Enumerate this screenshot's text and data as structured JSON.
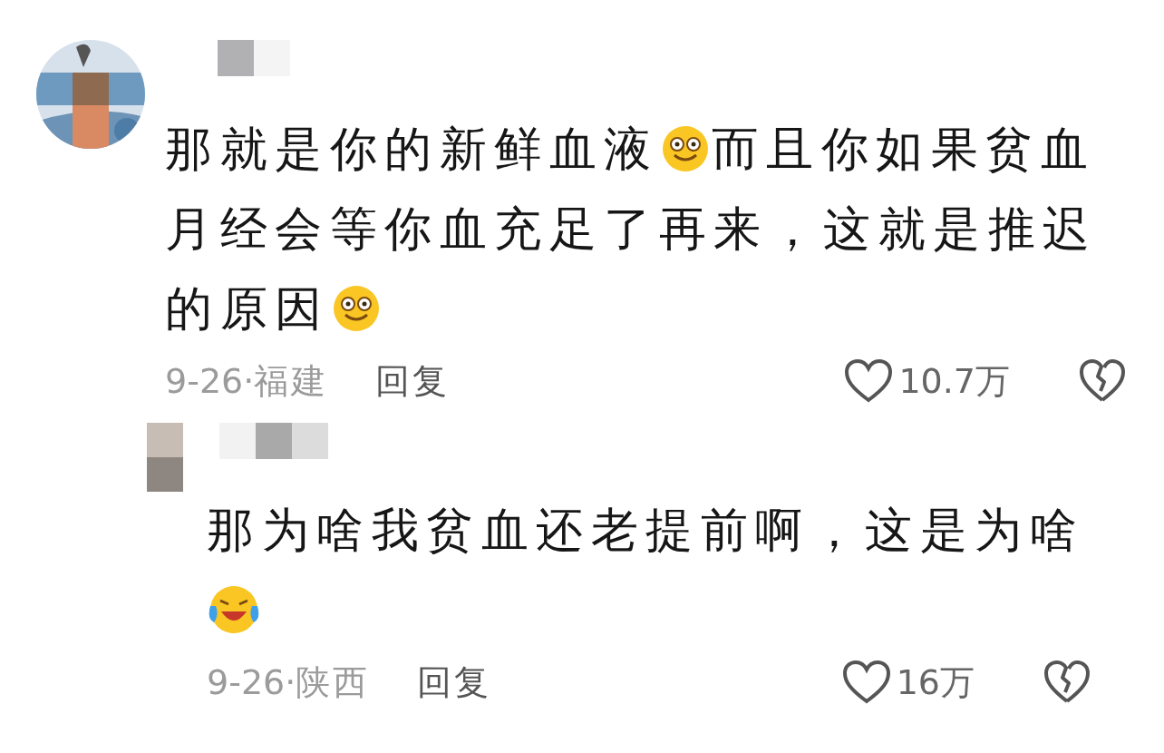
{
  "comments": [
    {
      "avatar": {
        "kind": "picture"
      },
      "body": [
        {
          "kind": "text",
          "text": "那就是你的新鲜血液"
        },
        {
          "kind": "smile"
        },
        {
          "kind": "text",
          "text": "而且你如果贫血月经会等你血充足了再来，这就是推迟的原因"
        },
        {
          "kind": "smile"
        }
      ],
      "date": "9-26·",
      "location": "福建",
      "reply": "回复",
      "likes": "10.7万",
      "replies": [
        {
          "avatar": {
            "kind": "picture"
          },
          "body": [
            {
              "kind": "text",
              "text": "那为啥我贫血还老提前啊，这是为啥"
            },
            {
              "kind": "laugh-cry"
            }
          ],
          "date": "9-26·",
          "location": "陕西",
          "reply": "回复",
          "likes": "16万"
        }
      ]
    }
  ]
}
